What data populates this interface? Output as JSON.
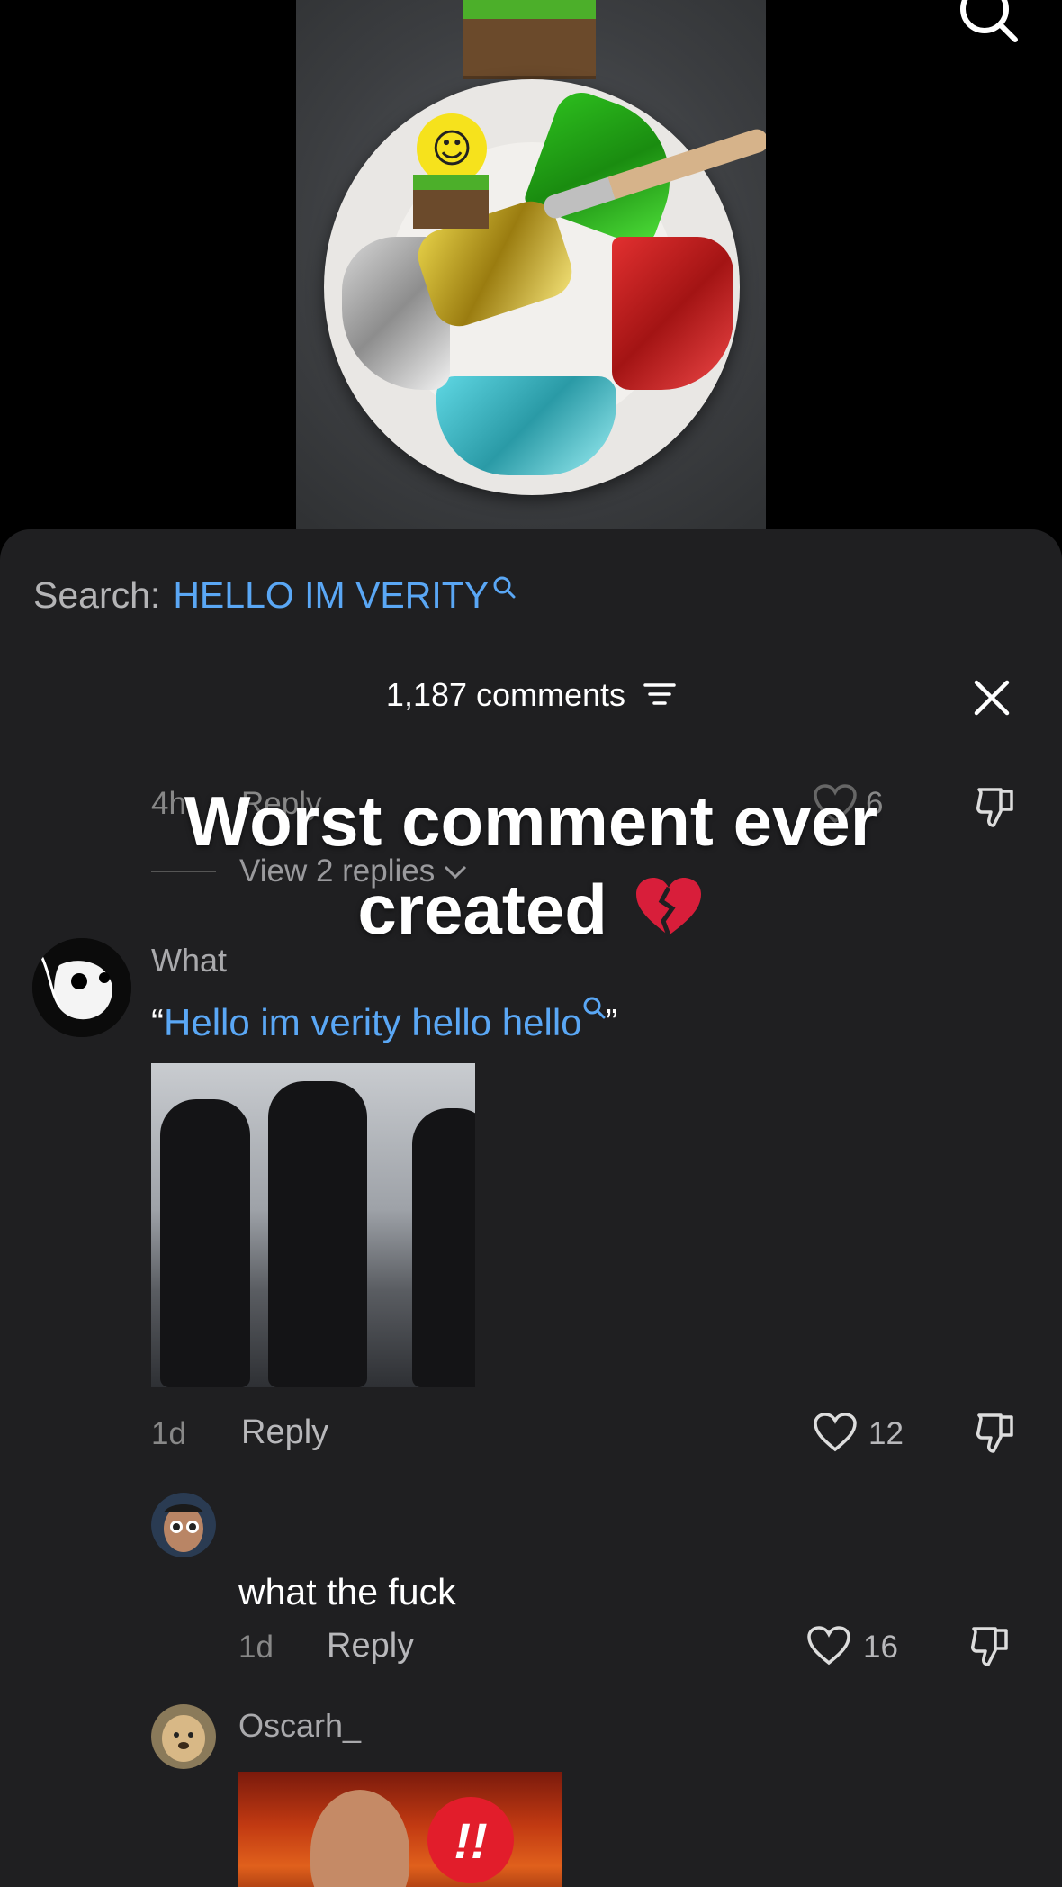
{
  "search": {
    "prefix": "Search:",
    "query": "HELLO IM VERITY"
  },
  "header": {
    "comment_count": "1,187 comments"
  },
  "overlay_caption": {
    "line1": "Worst comment ever",
    "line2": "created"
  },
  "previous_comment": {
    "time": "4h",
    "reply_label": "Reply",
    "like_count": "6",
    "view_replies_label": "View 2 replies"
  },
  "comments": [
    {
      "username": "What",
      "quote_open": "“",
      "link_text": "Hello im verity hello hello",
      "quote_close": "”",
      "time": "1d",
      "reply_label": "Reply",
      "like_count": "12"
    },
    {
      "text": "what the fuck",
      "time": "1d",
      "reply_label": "Reply",
      "like_count": "16"
    },
    {
      "username": "Oscarh_",
      "badge": "!!"
    }
  ],
  "colors": {
    "accent_link": "#5aa7f5",
    "sheet_bg": "#1f1f21"
  }
}
